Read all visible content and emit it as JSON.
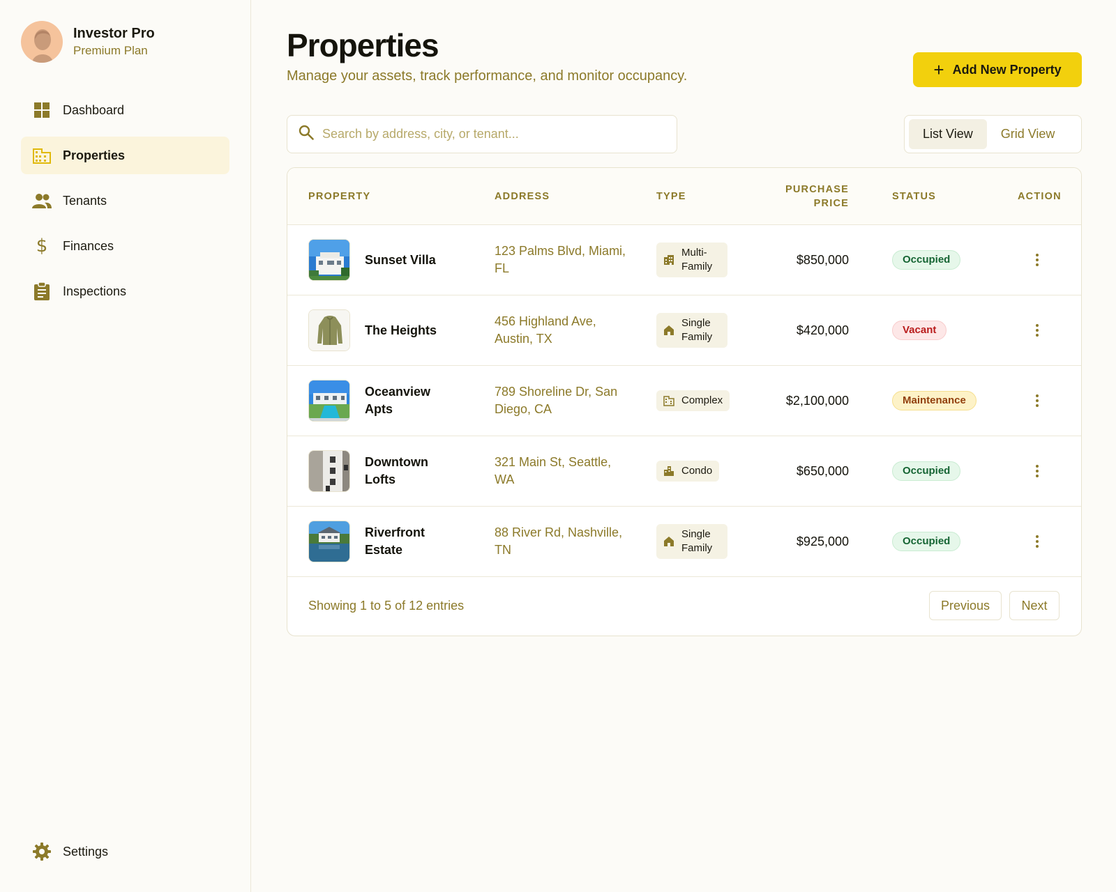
{
  "profile": {
    "name": "Investor Pro",
    "plan": "Premium Plan"
  },
  "nav": [
    {
      "label": "Dashboard",
      "icon": "dashboard-icon"
    },
    {
      "label": "Properties",
      "icon": "building-icon",
      "active": true
    },
    {
      "label": "Tenants",
      "icon": "people-icon"
    },
    {
      "label": "Finances",
      "icon": "dollar-icon"
    },
    {
      "label": "Inspections",
      "icon": "clipboard-icon"
    }
  ],
  "settings": {
    "label": "Settings",
    "icon": "gear-icon"
  },
  "header": {
    "title": "Properties",
    "subtitle": "Manage your assets, track performance, and monitor occupancy.",
    "add_button": "Add New Property"
  },
  "search": {
    "placeholder": "Search by address, city, or tenant..."
  },
  "view_toggle": {
    "list": "List View",
    "grid": "Grid View",
    "active": "list"
  },
  "table": {
    "columns": {
      "property": "PROPERTY",
      "address": "ADDRESS",
      "type": "TYPE",
      "price_line1": "PURCHASE",
      "price_line2": "PRICE",
      "status": "STATUS",
      "action": "ACTION"
    },
    "rows": [
      {
        "name": "Sunset Villa",
        "address": "123 Palms Blvd, Miami, FL",
        "type": "Multi-Family",
        "type_icon": "apartment-icon",
        "price": "$850,000",
        "status": "Occupied",
        "status_kind": "occupied",
        "thumb": "villa-thumbnail"
      },
      {
        "name": "The Heights",
        "address": "456 Highland Ave, Austin, TX",
        "type": "Single Family",
        "type_icon": "house-icon",
        "price": "$420,000",
        "status": "Vacant",
        "status_kind": "vacant",
        "thumb": "jacket-thumbnail"
      },
      {
        "name": "Oceanview Apts",
        "address": "789 Shoreline Dr, San Diego, CA",
        "type": "Complex",
        "type_icon": "building-icon",
        "price": "$2,100,000",
        "status": "Maintenance",
        "status_kind": "maintenance",
        "thumb": "pool-house-thumbnail"
      },
      {
        "name": "Downtown Lofts",
        "address": "321 Main St, Seattle, WA",
        "type": "Condo",
        "type_icon": "city-icon",
        "price": "$650,000",
        "status": "Occupied",
        "status_kind": "occupied",
        "thumb": "loft-building-thumbnail"
      },
      {
        "name": "Riverfront Estate",
        "address": "88 River Rd, Nashville, TN",
        "type": "Single Family",
        "type_icon": "house-icon",
        "price": "$925,000",
        "status": "Occupied",
        "status_kind": "occupied",
        "thumb": "lake-house-thumbnail"
      }
    ]
  },
  "footer": {
    "showing": "Showing 1 to 5 of 12 entries",
    "previous": "Previous",
    "next": "Next"
  },
  "colors": {
    "accent": "#f2d00d",
    "muted": "#8c7a2a",
    "active_nav_bg": "#fbf4dc"
  }
}
